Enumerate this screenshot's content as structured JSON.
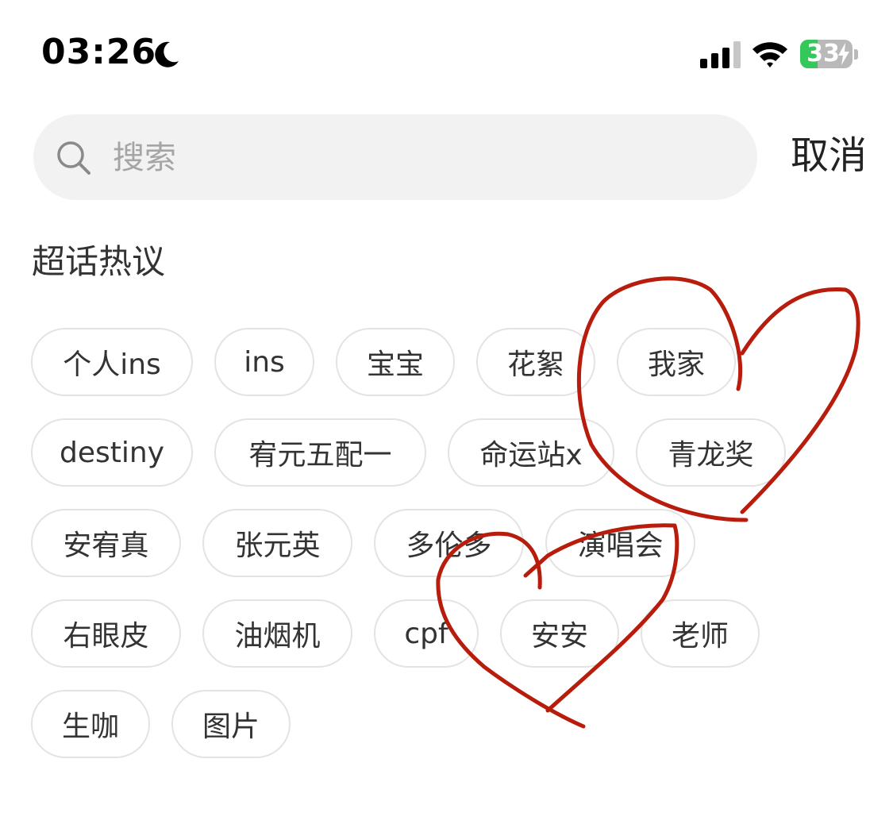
{
  "status_bar": {
    "time": "03:26",
    "battery": "33",
    "battery_level": 0.33,
    "moon_icon": "moon-icon",
    "signal_icon": "cellular-signal-icon",
    "wifi_icon": "wifi-icon",
    "battery_charging_icon": "bolt-icon"
  },
  "search": {
    "placeholder": "搜索",
    "value": "",
    "cancel_label": "取消",
    "icon": "search-icon"
  },
  "section": {
    "title": "超话热议"
  },
  "tags": [
    "个人ins",
    "ins",
    "宝宝",
    "花絮",
    "我家",
    "destiny",
    "宥元五配一",
    "命运站x",
    "青龙奖",
    "安宥真",
    "张元英",
    "多伦多",
    "演唱会",
    "右眼皮",
    "油烟机",
    "cpf",
    "安安",
    "老师",
    "生咖",
    "图片"
  ],
  "annotations": {
    "hearts_color": "#b71c0c",
    "hearts_description": "hand-drawn red hearts"
  }
}
